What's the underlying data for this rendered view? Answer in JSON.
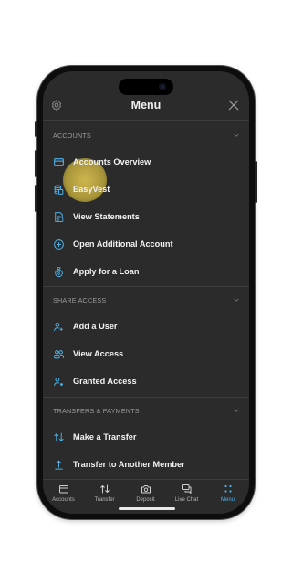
{
  "header": {
    "title": "Menu"
  },
  "sections": [
    {
      "label": "ACCOUNTS",
      "items": [
        {
          "label": "Accounts Overview",
          "icon": "card-icon"
        },
        {
          "label": "EasyVest",
          "icon": "coins-icon"
        },
        {
          "label": "View Statements",
          "icon": "statement-icon"
        },
        {
          "label": "Open Additional Account",
          "icon": "plus-circle-icon"
        },
        {
          "label": "Apply for a Loan",
          "icon": "moneybag-icon"
        }
      ]
    },
    {
      "label": "SHARE ACCESS",
      "items": [
        {
          "label": "Add a User",
          "icon": "add-user-icon"
        },
        {
          "label": "View Access",
          "icon": "users-icon"
        },
        {
          "label": "Granted Access",
          "icon": "user-check-icon"
        }
      ]
    },
    {
      "label": "TRANSFERS & PAYMENTS",
      "items": [
        {
          "label": "Make a Transfer",
          "icon": "transfer-arrows-icon"
        },
        {
          "label": "Transfer to Another Member",
          "icon": "upload-icon"
        }
      ]
    }
  ],
  "tabs": [
    {
      "label": "Accounts",
      "icon": "wallet-icon"
    },
    {
      "label": "Transfer",
      "icon": "transfer-icon"
    },
    {
      "label": "Deposit",
      "icon": "camera-icon"
    },
    {
      "label": "Live Chat",
      "icon": "chat-icon"
    },
    {
      "label": "Menu",
      "icon": "menu-dots-icon",
      "active": true
    }
  ],
  "colors": {
    "accent": "#4fb3e8",
    "icon": "#4fb3e8",
    "background": "#2b2b2b",
    "highlight": "#d6be50"
  }
}
